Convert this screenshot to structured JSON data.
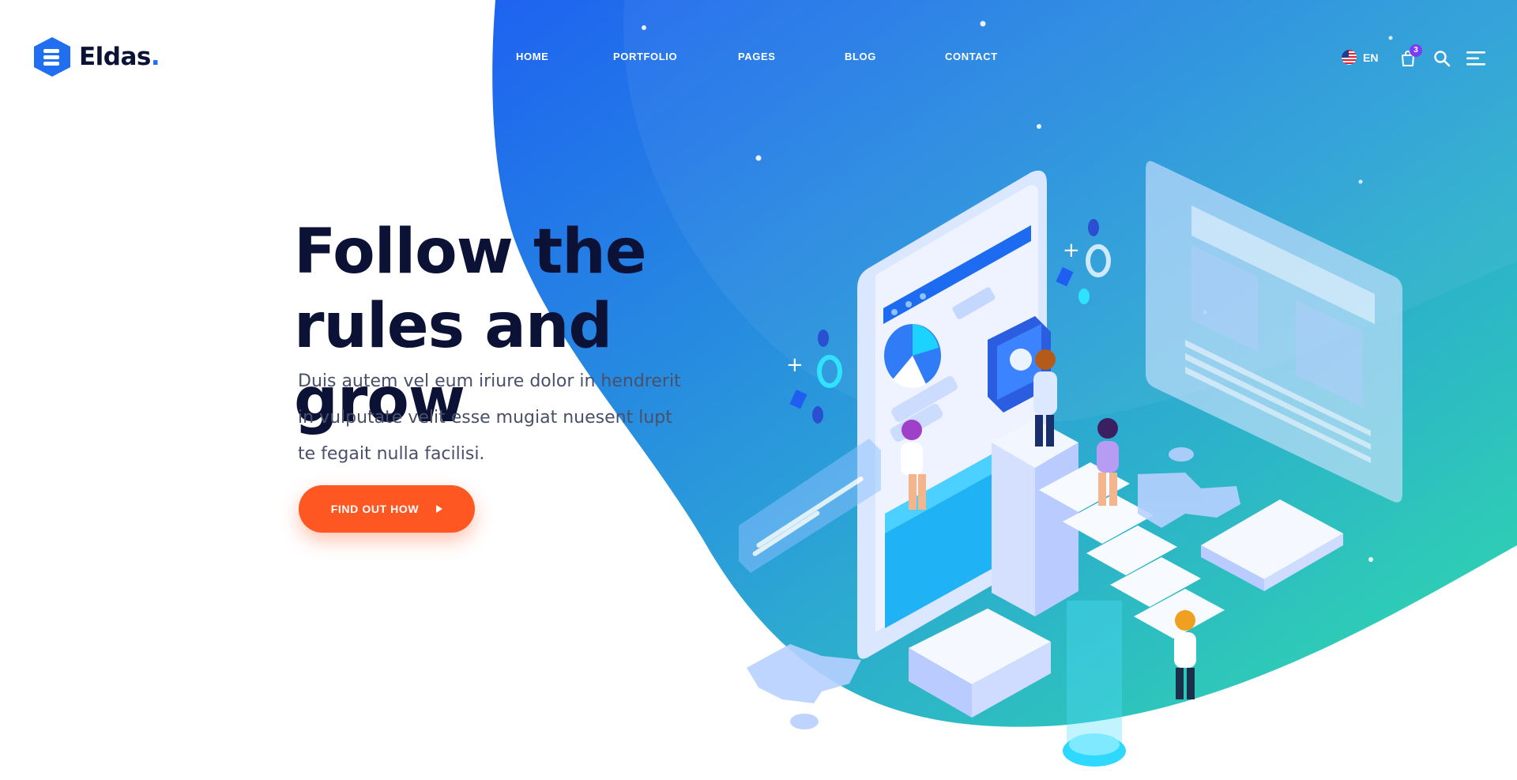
{
  "brand": {
    "name": "Eldas",
    "dot": ".",
    "logo_icon": "stack-hexagon-icon"
  },
  "nav": {
    "items": [
      {
        "label": "HOME"
      },
      {
        "label": "PORTFOLIO"
      },
      {
        "label": "PAGES"
      },
      {
        "label": "BLOG"
      },
      {
        "label": "CONTACT"
      }
    ]
  },
  "header": {
    "language": "EN",
    "language_icon": "us-flag-icon",
    "cart_icon": "shopping-bag-icon",
    "cart_count": "3",
    "search_icon": "search-icon",
    "menu_icon": "menu-icon"
  },
  "hero": {
    "headline_line1": "Follow the",
    "headline_line2": "rules and grow",
    "lede_line1": "Duis autem vel eum iriure dolor in hendrerit",
    "lede_line2": "in vulputate velit esse mugiat nuesent lupt",
    "lede_line3": "te fegait nulla facilisi.",
    "cta_label": "FIND OUT HOW",
    "cta_icon": "play-triangle-icon"
  },
  "colors": {
    "accent_blue": "#1f6ff0",
    "accent_teal": "#2ed3b0",
    "cta_orange": "#ff5722",
    "heading_navy": "#0b1236",
    "badge_purple": "#7b3cf6"
  }
}
